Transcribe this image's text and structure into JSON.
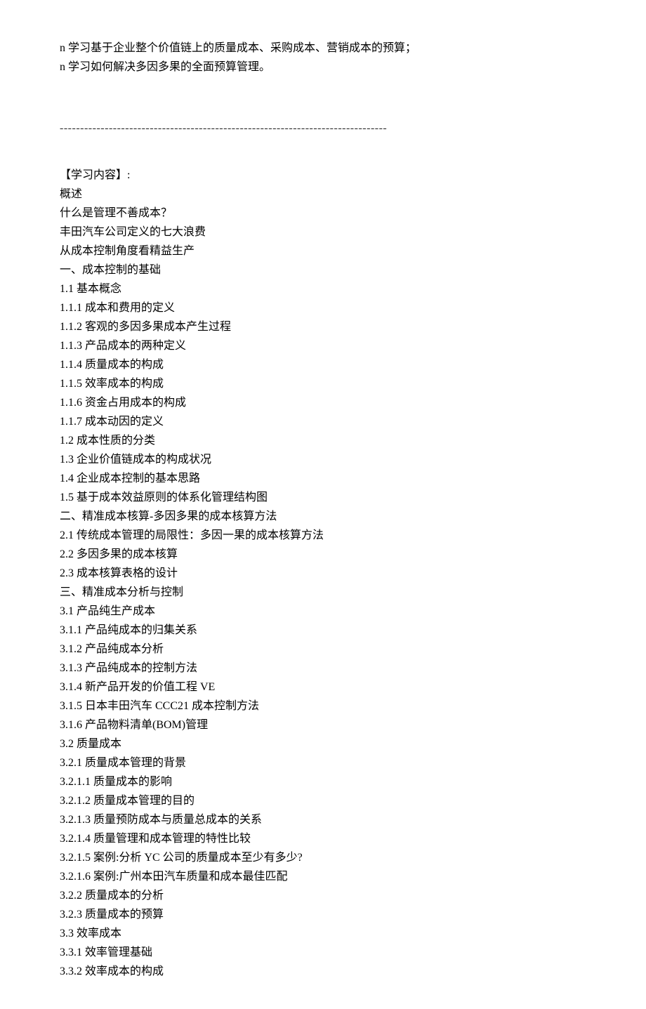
{
  "intro": [
    "n 学习基于企业整个价值链上的质量成本、采购成本、营销成本的预算；",
    "n 学习如何解决多因多果的全面预算管理。"
  ],
  "divider": "--------------------------------------------------------------------------------",
  "section_title": "【学习内容】:",
  "content": [
    "概述",
    "什么是管理不善成本？",
    "丰田汽车公司定义的七大浪费",
    "从成本控制角度看精益生产",
    "一、成本控制的基础",
    "1.1 基本概念",
    "1.1.1 成本和费用的定义",
    "1.1.2 客观的多因多果成本产生过程",
    "1.1.3 产品成本的两种定义",
    "1.1.4 质量成本的构成",
    "1.1.5 效率成本的构成",
    "1.1.6 资金占用成本的构成",
    "1.1.7 成本动因的定义",
    "1.2 成本性质的分类",
    "1.3 企业价值链成本的构成状况",
    "1.4 企业成本控制的基本思路",
    "1.5 基于成本效益原则的体系化管理结构图",
    "二、精准成本核算-多因多果的成本核算方法",
    "2.1 传统成本管理的局限性：多因一果的成本核算方法",
    "2.2 多因多果的成本核算",
    "2.3 成本核算表格的设计",
    "三、精准成本分析与控制",
    "3.1 产品纯生产成本",
    "3.1.1 产品纯成本的归集关系",
    "3.1.2 产品纯成本分析",
    "3.1.3 产品纯成本的控制方法",
    "3.1.4 新产品开发的价值工程 VE",
    "3.1.5 日本丰田汽车 CCC21 成本控制方法",
    "3.1.6 产品物料清单(BOM)管理",
    "3.2 质量成本",
    "3.2.1 质量成本管理的背景",
    "3.2.1.1 质量成本的影响",
    "3.2.1.2 质量成本管理的目的",
    "3.2.1.3 质量预防成本与质量总成本的关系",
    "3.2.1.4 质量管理和成本管理的特性比较",
    "3.2.1.5 案例:分析 YC 公司的质量成本至少有多少?",
    "3.2.1.6 案例:广州本田汽车质量和成本最佳匹配",
    "3.2.2 质量成本的分析",
    "3.2.3 质量成本的预算",
    "3.3 效率成本",
    "3.3.1 效率管理基础",
    "3.3.2 效率成本的构成"
  ]
}
